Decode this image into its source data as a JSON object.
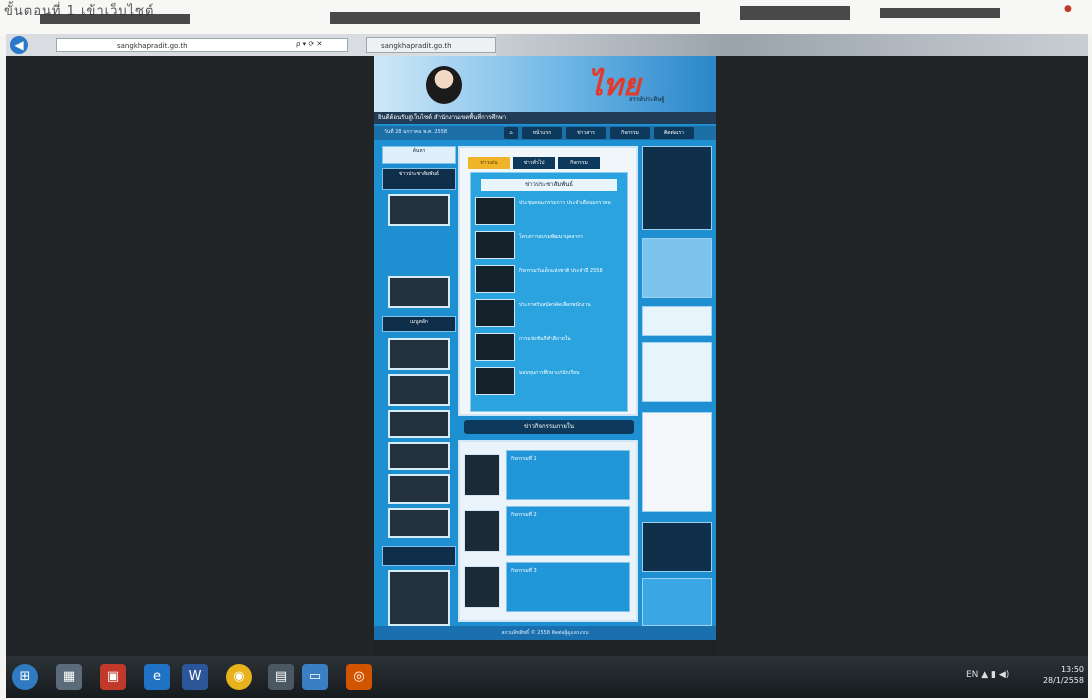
{
  "photo_caption": "ขั้นตอนที่ 1 เข้าเว็บไซต์",
  "browser": {
    "back_icon": "back-arrow-icon",
    "address": "sangkhapradit.go.th",
    "address_controls": "ρ ▾ ⟳ ✕",
    "tab_title": "sangkhapradit.go.th"
  },
  "site": {
    "logo_text": "ไทย",
    "logo_subtitle": "สรรค์ประดิษฐ์",
    "marquee": "ยินดีต้อนรับสู่เว็บไซต์ สำนักงานเขตพื้นที่การศึกษา",
    "date_text": "วันที่ 28 มกราคม พ.ศ. 2558",
    "nav": [
      "หน้าแรก",
      "ข่าวสาร",
      "กิจกรรม",
      "ติดต่อเรา"
    ],
    "left_labels": [
      "ค้นหา",
      "ข่าวประชาสัมพันธ์",
      "เมนูหลัก"
    ],
    "tabs": [
      "ข่าวเด่น",
      "ข่าวทั่วไป",
      "กิจกรรม"
    ],
    "panel_title": "ข่าวประชาสัมพันธ์",
    "news": [
      "ประชุมคณะกรรมการ ประจำเดือนมกราคม",
      "โครงการอบรมพัฒนาบุคลากร",
      "กิจกรรมวันเด็กแห่งชาติ ประจำปี 2558",
      "ประกาศรับสมัครคัดเลือกพนักงาน",
      "การแข่งขันกีฬาสีภายใน",
      "มอบทุนการศึกษาแก่นักเรียน"
    ],
    "section_heading": "ข่าวกิจกรรมภายใน",
    "lower_items": [
      "กิจกรรมที่ 1",
      "กิจกรรมที่ 2",
      "กิจกรรมที่ 3"
    ],
    "footer": "สงวนลิขสิทธิ์ © 2558 ติดต่อผู้ดูแลระบบ"
  },
  "taskbar": {
    "icons": [
      "start-orb-icon",
      "library-icon",
      "media-icon",
      "ie-icon",
      "word-icon",
      "chrome-icon",
      "app-icon",
      "folder-icon",
      "line-icon"
    ],
    "tray": "EN ▲ ▮ ◀)",
    "time": "13:50",
    "date": "28/1/2558"
  },
  "colors": {
    "site_blue": "#1e8fd0",
    "nav_dark": "#0d3a5c",
    "accent_orange": "#f0b429",
    "logo_red": "#e13a2a"
  }
}
